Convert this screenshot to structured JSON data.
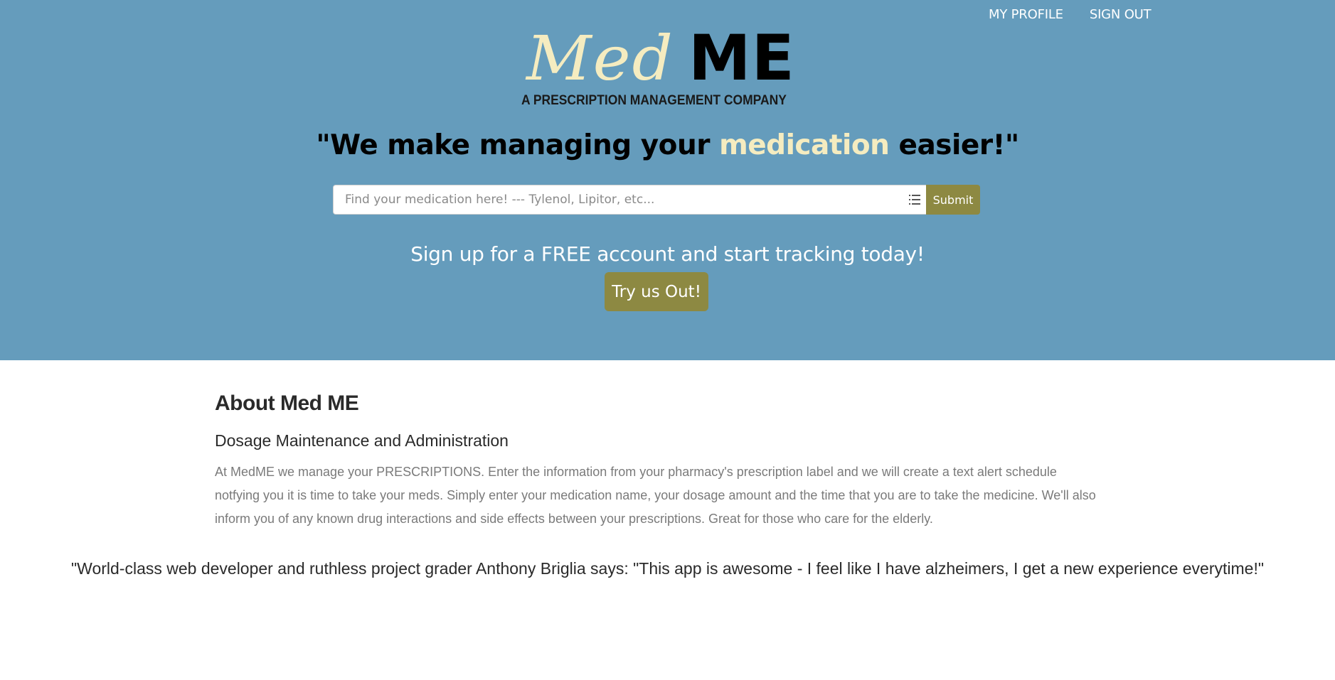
{
  "nav": {
    "profile_label": "MY PROFILE",
    "signout_label": "SIGN OUT"
  },
  "logo": {
    "med": "Med",
    "me": "ME",
    "subtitle": "A PRESCRIPTION MANAGEMENT COMPANY"
  },
  "tagline": {
    "before": "\"We make managing your ",
    "highlight": "medication",
    "after": " easier!\""
  },
  "search": {
    "placeholder": "Find your medication here! --- Tylenol, Lipitor, etc...",
    "value": "",
    "submit_label": "Submit",
    "list_icon": "list-icon"
  },
  "signup": {
    "text": "Sign up for a FREE account and start tracking today!",
    "button_label": "Try us Out!"
  },
  "about": {
    "title": "About Med ME",
    "subtitle": "Dosage Maintenance and Administration",
    "body": "At MedME we manage your PRESCRIPTIONS. Enter the information from your pharmacy's prescription label and we will create a text alert schedule notfying you it is time to take your meds. Simply enter your medication name, your dosage amount and the time that you are to take the medicine. We'll also inform you of any known drug interactions and side effects between your prescriptions. Great for those who care for the elderly."
  },
  "quote": "\"World-class web developer and ruthless project grader Anthony Briglia says: \"This app is awesome - I feel like I have alzheimers, I get a new experience everytime!\"",
  "colors": {
    "hero_bg": "#659cbc",
    "accent": "#8d8942",
    "logo_cream": "#f5ecc0"
  }
}
